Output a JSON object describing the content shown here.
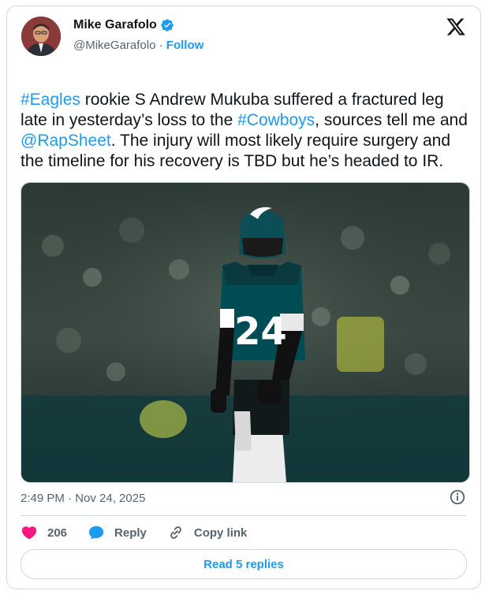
{
  "author": {
    "name": "Mike Garafolo",
    "handle": "@MikeGarafolo",
    "separator": " · ",
    "follow_label": "Follow",
    "verified_icon": "verified-badge-icon"
  },
  "tweet": {
    "segments": [
      {
        "text": "#Eagles",
        "type": "link"
      },
      {
        "text": " rookie S Andrew Mukuba suffered a fractured leg late in yesterday’s loss to the ",
        "type": "plain"
      },
      {
        "text": "#Cowboys",
        "type": "link"
      },
      {
        "text": ", sources tell me and ",
        "type": "plain"
      },
      {
        "text": "@RapSheet",
        "type": "link"
      },
      {
        "text": ". The injury will most likely require surgery and the timeline for his recovery is TBD but he’s headed to IR.",
        "type": "plain"
      }
    ],
    "timestamp": "2:49 PM · Nov 24, 2025"
  },
  "actions": {
    "like_count": "206",
    "reply_label": "Reply",
    "copy_label": "Copy link",
    "read_replies_label": "Read 5 replies"
  },
  "photo": {
    "jersey_number": "24"
  },
  "colors": {
    "accent": "#1d9bf0",
    "like": "#f91880",
    "reply": "#1d9bf0",
    "eagles_green": "#004c54"
  }
}
